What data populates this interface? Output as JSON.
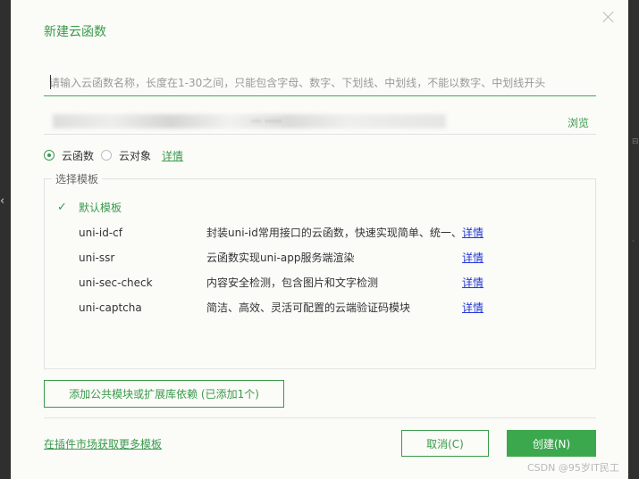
{
  "dialog": {
    "title": "新建云函数",
    "name_input": {
      "placeholder": "请输入云函数名称，长度在1-30之间，只能包含字母、数字、下划线、中划线，不能以数字、中划线开头",
      "value": ""
    },
    "path": {
      "visible_text": "··· ·····",
      "browse_label": "浏览"
    },
    "type_options": [
      {
        "label": "云函数",
        "selected": true
      },
      {
        "label": "云对象",
        "selected": false
      }
    ],
    "type_detail_label": "详情",
    "template_section": {
      "legend": "选择模板",
      "templates": [
        {
          "name": "默认模板",
          "description": "",
          "detail": "",
          "selected": true
        },
        {
          "name": "uni-id-cf",
          "description": "封装uni-id常用接口的云函数，快速实现简单、统一、",
          "detail": "详情",
          "selected": false
        },
        {
          "name": "uni-ssr",
          "description": "云函数实现uni-app服务端渲染",
          "detail": "详情",
          "selected": false
        },
        {
          "name": "uni-sec-check",
          "description": "内容安全检测，包含图片和文字检测",
          "detail": "详情",
          "selected": false
        },
        {
          "name": "uni-captcha",
          "description": "简洁、高效、灵活可配置的云端验证码模块",
          "detail": "详情",
          "selected": false
        }
      ]
    },
    "add_module_label": "添加公共模块或扩展库依赖 (已添加1个)",
    "market_link_label": "在插件市场获取更多模板",
    "cancel_label": "取消(C)",
    "create_label": "创建(N)",
    "accent_color": "#3ca84e",
    "link_color": "#2237d6"
  },
  "watermark": "CSDN @95岁IT民工"
}
